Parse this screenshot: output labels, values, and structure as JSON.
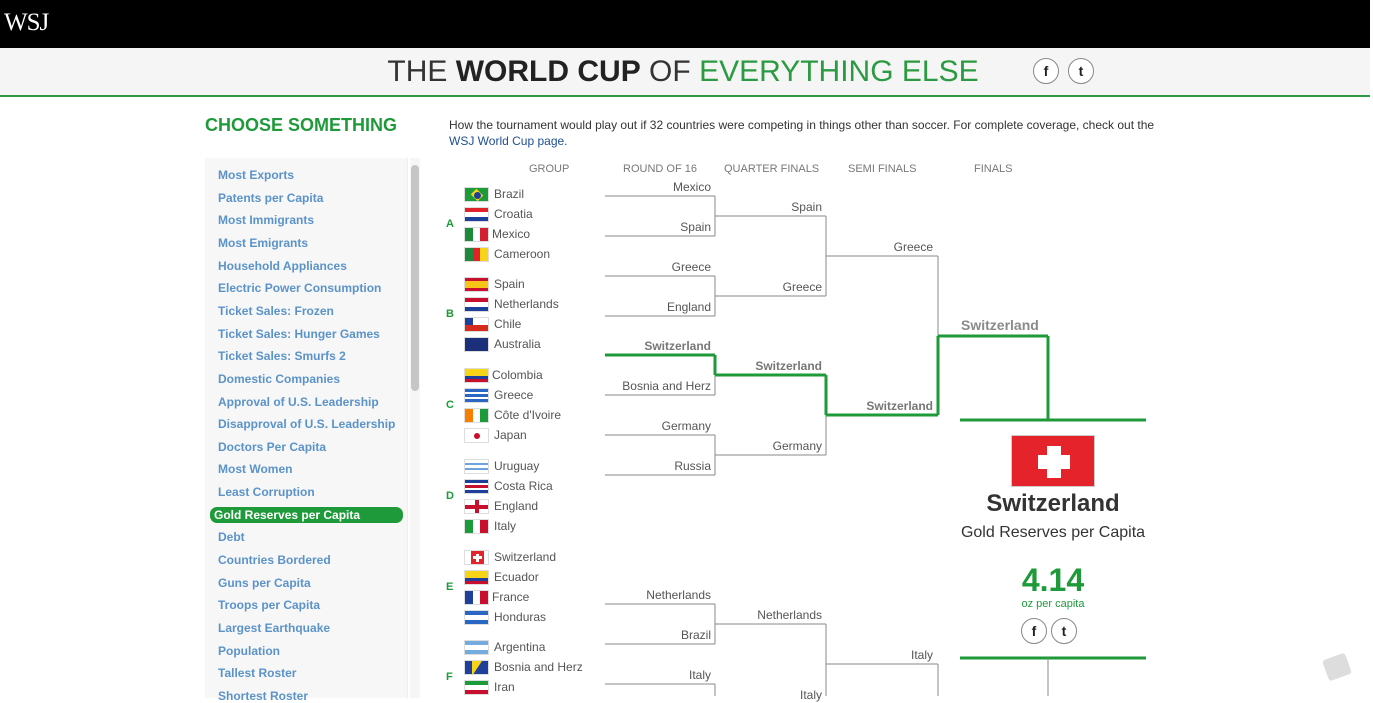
{
  "header": {
    "logo": "WSJ",
    "title_part1": "THE ",
    "title_part2": "WORLD CUP",
    "title_part3": " OF ",
    "title_part4": "EVERYTHING ELSE",
    "facebook": "f",
    "twitter": "t"
  },
  "sidebar": {
    "heading": "CHOOSE SOMETHING",
    "items": [
      "Most Exports",
      "Patents per Capita",
      "Most Immigrants",
      "Most Emigrants",
      "Household Appliances",
      "Electric Power Consumption",
      "Ticket Sales: Frozen",
      "Ticket Sales: Hunger Games",
      "Ticket Sales: Smurfs 2",
      "Domestic Companies",
      "Approval of U.S. Leadership",
      "Disapproval of U.S. Leadership",
      "Doctors Per Capita",
      "Most Women",
      "Least Corruption",
      "Gold Reserves per Capita",
      "Debt",
      "Countries Bordered",
      "Guns per Capita",
      "Troops per Capita",
      "Largest Earthquake",
      "Population",
      "Tallest Roster",
      "Shortest Roster"
    ],
    "selected": "Gold Reserves per Capita"
  },
  "intro": {
    "text": "How the tournament would play out if 32 countries were competing in things other than soccer. For complete coverage, check out the",
    "link": "WSJ World Cup page."
  },
  "bracket": {
    "columns": [
      "GROUP",
      "ROUND OF 16",
      "QUARTER FINALS",
      "SEMI FINALS",
      "FINALS"
    ],
    "groups": [
      {
        "name": "A",
        "teams": [
          "Brazil",
          "Croatia",
          "Mexico",
          "Cameroon"
        ]
      },
      {
        "name": "B",
        "teams": [
          "Spain",
          "Netherlands",
          "Chile",
          "Australia"
        ]
      },
      {
        "name": "C",
        "teams": [
          "Colombia",
          "Greece",
          "Côte d'Ivoire",
          "Japan"
        ]
      },
      {
        "name": "D",
        "teams": [
          "Uruguay",
          "Costa Rica",
          "England",
          "Italy"
        ]
      },
      {
        "name": "E",
        "teams": [
          "Switzerland",
          "Ecuador",
          "France",
          "Honduras"
        ]
      },
      {
        "name": "F",
        "teams": [
          "Argentina",
          "Bosnia and Herz",
          "Iran"
        ]
      }
    ],
    "round_of_16": [
      "Mexico",
      "Spain",
      "Greece",
      "England",
      "Switzerland",
      "Bosnia and Herz",
      "Germany",
      "Russia",
      "Netherlands",
      "Brazil",
      "Italy"
    ],
    "quarter_finals": [
      "Spain",
      "Greece",
      "Switzerland",
      "Germany",
      "Netherlands",
      "Italy"
    ],
    "semi_finals": [
      "Greece",
      "Switzerland",
      "Italy"
    ],
    "finals": [
      "Switzerland"
    ]
  },
  "result": {
    "country": "Switzerland",
    "category": "Gold Reserves per Capita",
    "value": "4.14",
    "unit": "oz per capita",
    "accent": "#1f9a3a"
  }
}
